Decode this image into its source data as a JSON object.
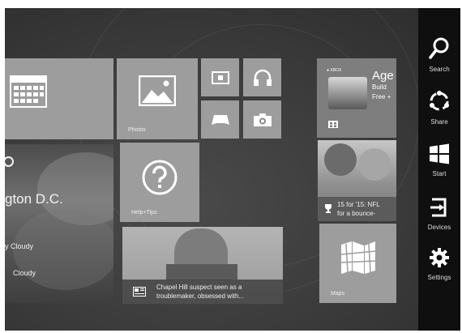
{
  "tiles": {
    "photos_label": "Photos",
    "help_label": "Help+Tips",
    "maps_label": "Maps",
    "weather": {
      "location": "gton D.C.",
      "line1": "y Cloudy",
      "line2": "Cloudy"
    },
    "news": {
      "headline_line1": "Chapel Hill suspect seen as a",
      "headline_line2": "troublemaker, obsessed with..."
    },
    "game": {
      "title": "Age",
      "line1": "Build",
      "line2": "Free +"
    },
    "sports": {
      "line1": "15 for '15: NFL",
      "line2": "for a bounce-"
    }
  },
  "charms": [
    {
      "label": "Search",
      "icon": "search-icon"
    },
    {
      "label": "Share",
      "icon": "share-icon"
    },
    {
      "label": "Start",
      "icon": "windows-start-icon"
    },
    {
      "label": "Devices",
      "icon": "devices-icon"
    },
    {
      "label": "Settings",
      "icon": "settings-gear-icon"
    }
  ],
  "colors": {
    "background": "#3d3d3d",
    "tile": "#8a8a8a",
    "charm_bar": "#0f0f0f",
    "text": "#eeeeee"
  }
}
